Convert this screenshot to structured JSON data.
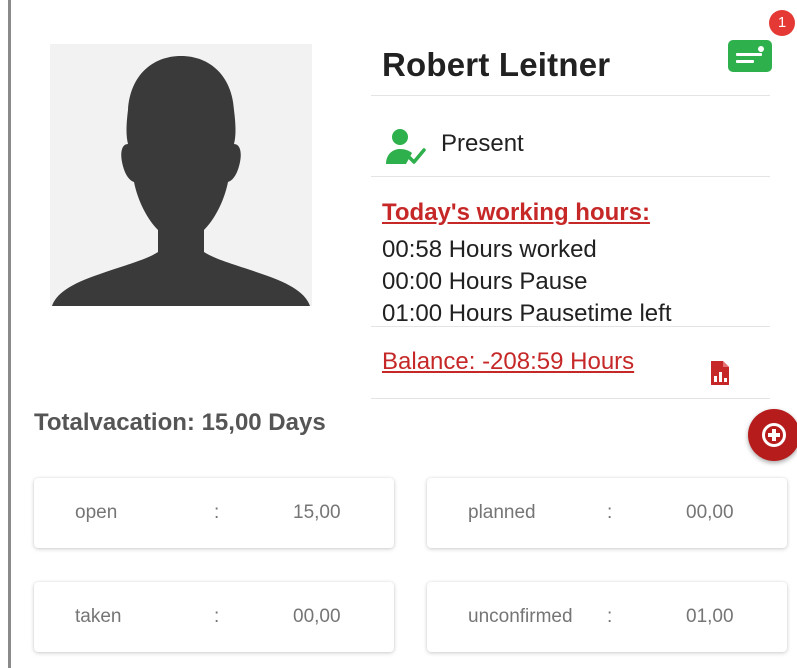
{
  "profile": {
    "name": "Robert Leitner",
    "avatar_icon": "person-silhouette-icon"
  },
  "header": {
    "message_icon": "message-icon",
    "notification_count": "1",
    "accent_color": "#2eb04c",
    "badge_color": "#e53935"
  },
  "status": {
    "icon": "person-check-icon",
    "label": "Present",
    "color": "#2eb04c"
  },
  "working_hours": {
    "title": "Today's working hours:",
    "lines": [
      "00:58 Hours worked",
      "00:00 Hours Pause",
      "01:00 Hours Pausetime left"
    ],
    "color": "#c62828"
  },
  "balance": {
    "label": "Balance: -208:59 Hours",
    "report_icon": "report-document-icon"
  },
  "vacation": {
    "total_label": "Totalvacation: 15,00 Days",
    "add_icon": "add-circle-icon",
    "add_color": "#b71c1c",
    "cards": [
      {
        "label": "open",
        "separator": ":",
        "value": "15,00"
      },
      {
        "label": "planned",
        "separator": ":",
        "value": "00,00"
      },
      {
        "label": "taken",
        "separator": ":",
        "value": "00,00"
      },
      {
        "label": "unconfirmed",
        "separator": ":",
        "value": "01,00"
      }
    ]
  }
}
